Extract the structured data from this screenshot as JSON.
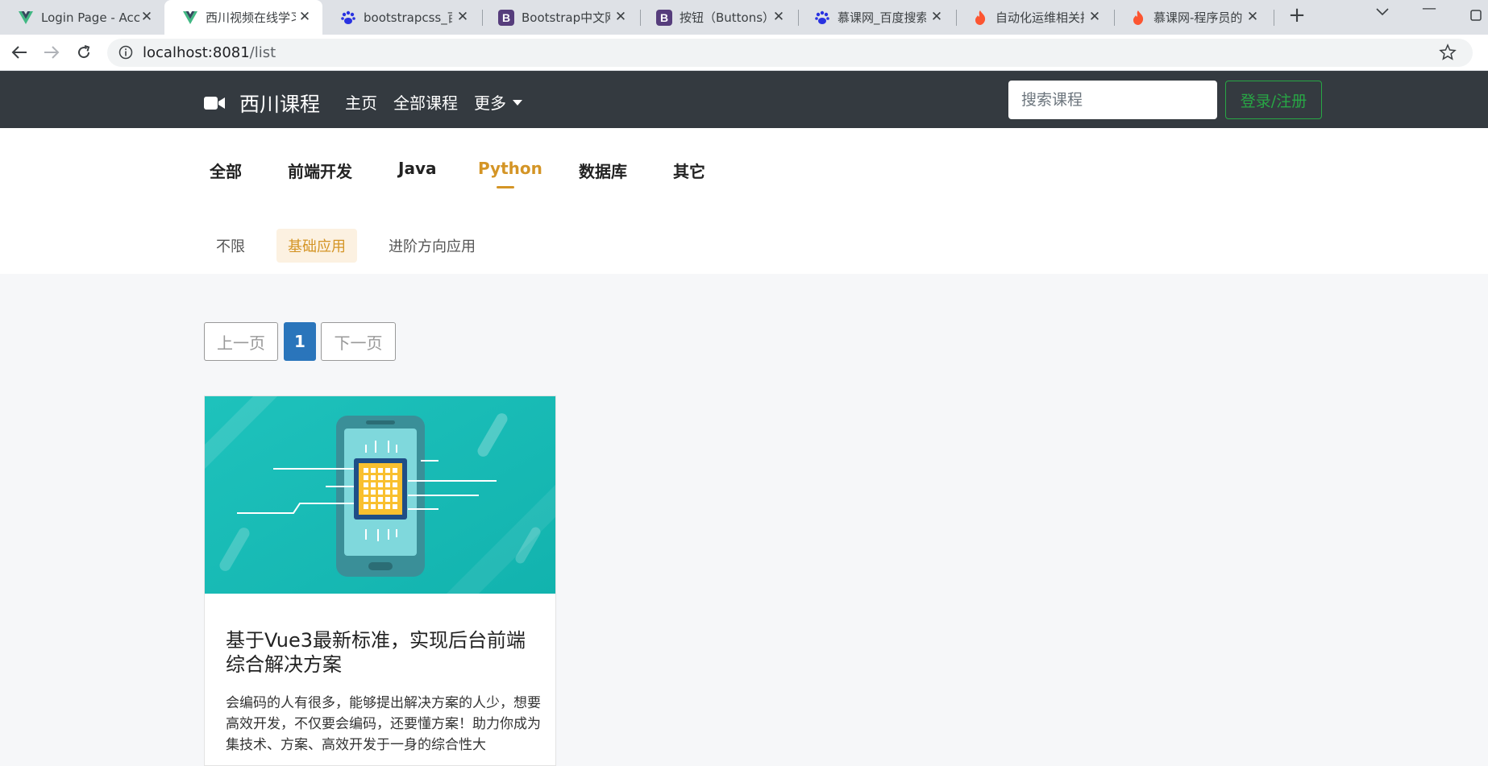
{
  "browser": {
    "tabs": [
      {
        "title": "Login Page - Acc",
        "favicon": "vue-icon"
      },
      {
        "title": "西川视频在线学习",
        "favicon": "vue-icon"
      },
      {
        "title": "bootstrapcss_百",
        "favicon": "baidu-icon"
      },
      {
        "title": "Bootstrap中文网",
        "favicon": "bootstrap-icon"
      },
      {
        "title": "按钮（Buttons）",
        "favicon": "bootstrap-icon"
      },
      {
        "title": "慕课网_百度搜索",
        "favicon": "baidu-icon"
      },
      {
        "title": "自动化运维相关技",
        "favicon": "csdn-flame-icon"
      },
      {
        "title": "慕课网-程序员的梦",
        "favicon": "csdn-flame-icon"
      }
    ],
    "url_host": "localhost:8081",
    "url_path": "/list"
  },
  "navbar": {
    "brand": "西川课程",
    "links": [
      "主页",
      "全部课程",
      "更多"
    ],
    "search_placeholder": "搜索课程",
    "login_label": "登录/注册"
  },
  "categories": [
    "全部",
    "前端开发",
    "Java",
    "Python",
    "数据库",
    "其它"
  ],
  "active_category": "Python",
  "subcategories": [
    "不限",
    "基础应用",
    "进阶方向应用"
  ],
  "active_subcategory": "基础应用",
  "pagination": {
    "prev": "上一页",
    "current": "1",
    "next": "下一页"
  },
  "course": {
    "title": "基于Vue3最新标准，实现后台前端综合解决方案",
    "description": "会编码的人有很多，能够提出解决方案的人少，想要高效开发，不仅要会编码，还要懂方案！助力你成为集技术、方案、高效开发于一身的综合性大"
  },
  "colors": {
    "navbar_bg": "#343a40",
    "accent": "#d49526",
    "login_green": "#28a745",
    "page_active": "#2a75bb"
  }
}
